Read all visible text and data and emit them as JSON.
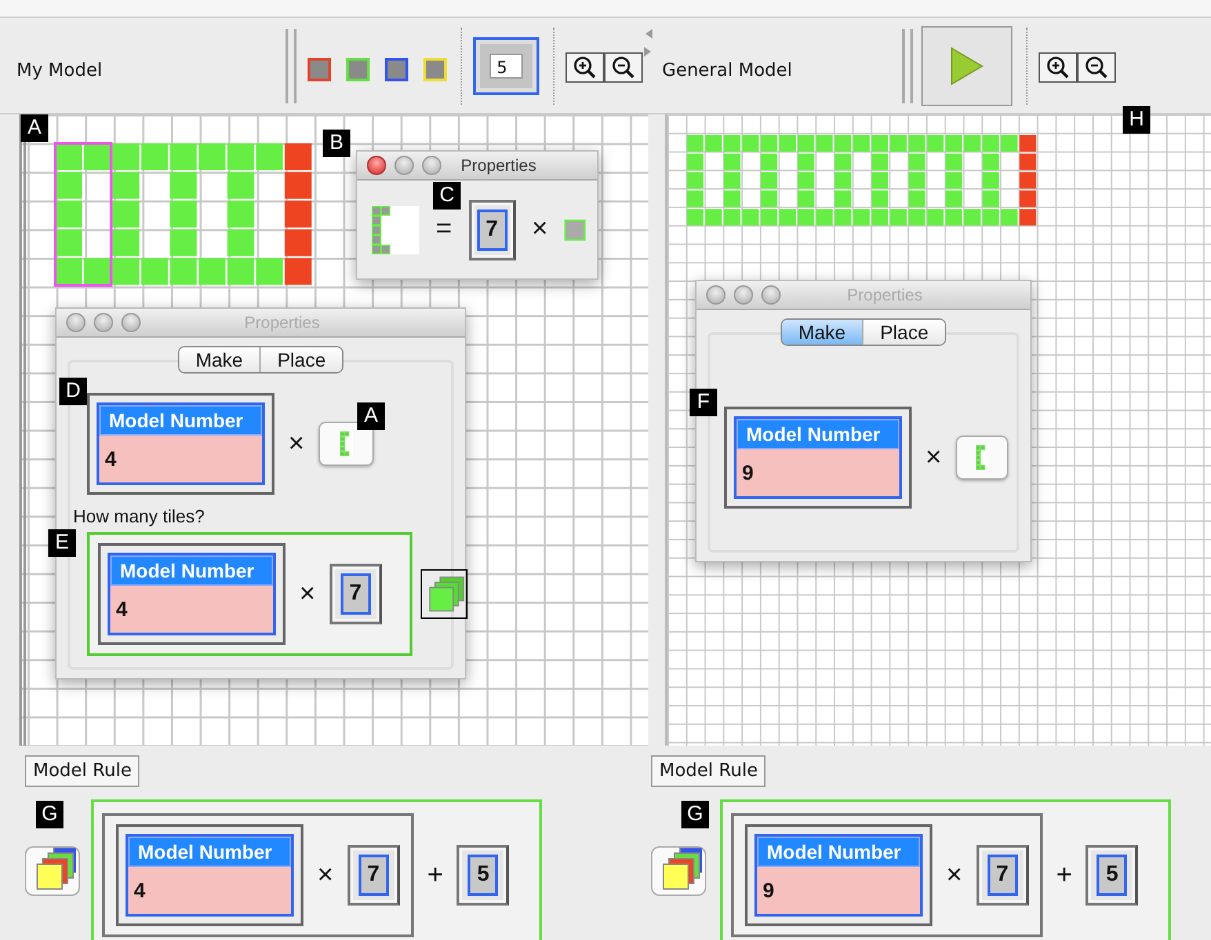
{
  "toolbar": {
    "my_model_label": "My Model",
    "tile_colors": [
      {
        "color": "#e0452c"
      },
      {
        "color": "#66dd44"
      },
      {
        "color": "#3355ee"
      },
      {
        "color": "#eedd33"
      }
    ],
    "repeat_value": "5",
    "general_model_label": "General Model"
  },
  "my_model": {
    "marker": "A",
    "highlighted": true
  },
  "rule_window": {
    "marker": "B",
    "title": "Properties",
    "active": true,
    "value_marker": "C",
    "equals": "=",
    "factor": "7",
    "times": "×"
  },
  "left_window": {
    "title": "Properties",
    "active": false,
    "tabs": [
      {
        "label": "Make",
        "selected": false
      },
      {
        "label": "Place",
        "selected": false
      }
    ],
    "expression": {
      "marker": "D",
      "header": "Model Number",
      "value": "4",
      "times": "×",
      "tile_marker": "A"
    },
    "question": "How many tiles?",
    "count": {
      "marker": "E",
      "header": "Model Number",
      "value": "4",
      "times": "×",
      "factor": "7"
    }
  },
  "general_model": {
    "marker": "H",
    "highlighted": false
  },
  "right_window": {
    "title": "Properties",
    "active": false,
    "tabs": [
      {
        "label": "Make",
        "selected": true
      },
      {
        "label": "Place",
        "selected": false
      }
    ],
    "expression": {
      "marker": "F",
      "header": "Model Number",
      "value": "9",
      "times": "×"
    }
  },
  "rules": [
    {
      "button": "Model Rule",
      "marker": "G",
      "header": "Model Number",
      "value": "4",
      "times": "×",
      "factor": "7",
      "plus": "+",
      "constant": "5"
    },
    {
      "button": "Model Rule",
      "marker": "G",
      "header": "Model Number",
      "value": "9",
      "times": "×",
      "factor": "7",
      "plus": "+",
      "constant": "5"
    }
  ]
}
